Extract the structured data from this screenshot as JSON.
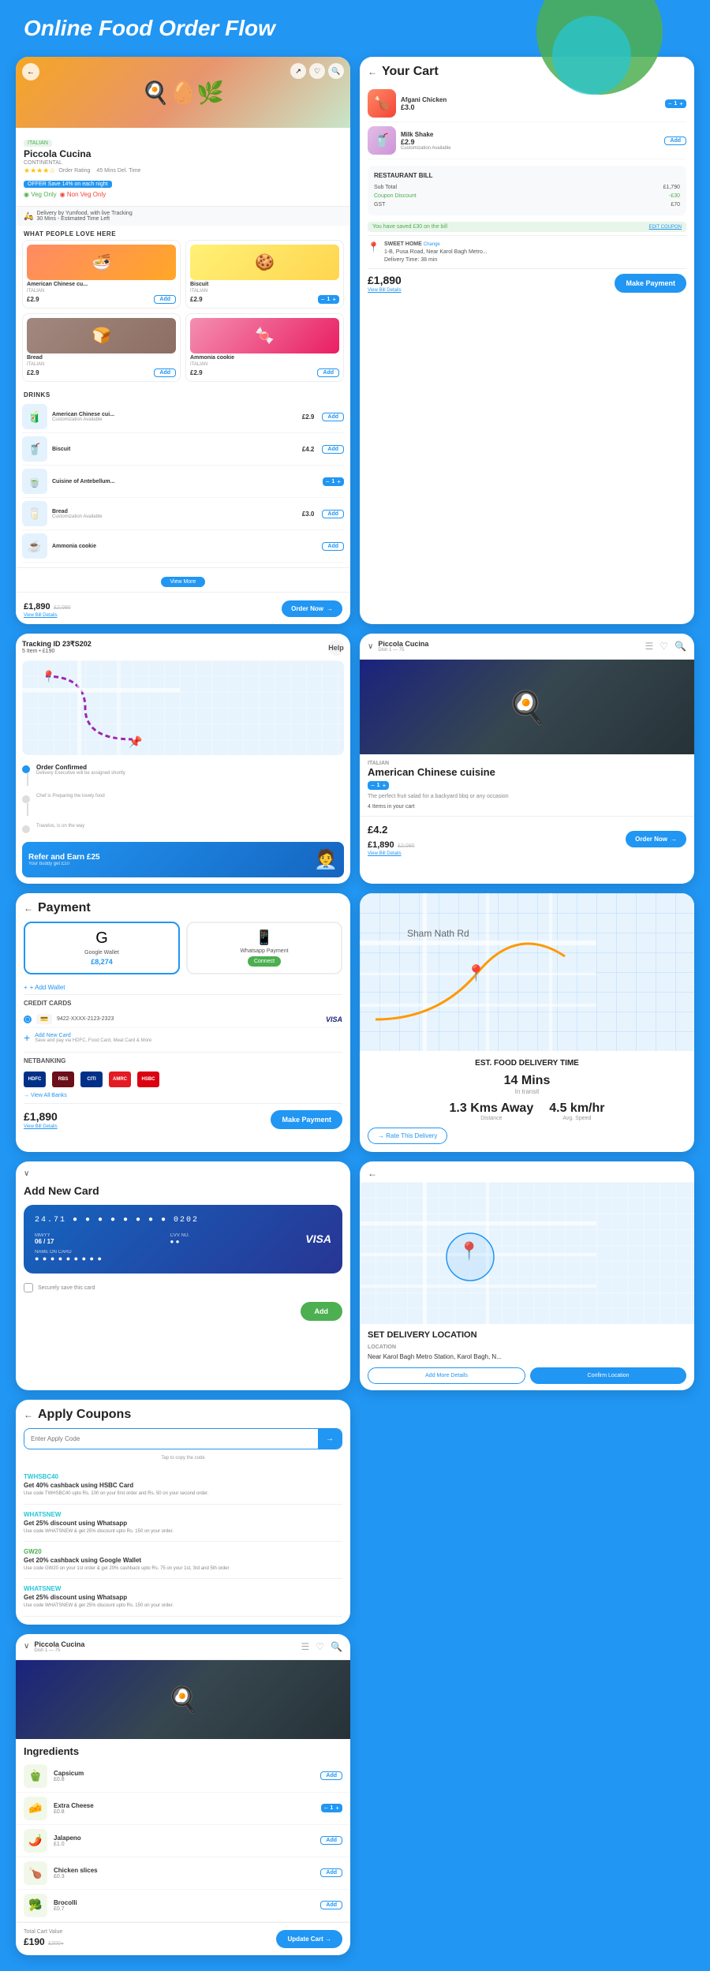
{
  "page": {
    "title": "Online Food Order Flow",
    "bg_color": "#2196F3"
  },
  "restaurant_card": {
    "name": "Piccola Cucina",
    "tag": "ITALIAN",
    "cuisine": "CONTINENTAL",
    "rating": "4.2",
    "rating_count": "Order Rating",
    "time": "45 Mins Del. Time",
    "offer": "OFFER Save 14% on each night",
    "veg_only": "Veg Only",
    "non_veg": "Non Veg Only",
    "delivery_by": "Delivery by Yumfood, with live Tracking",
    "delivery_time": "30 Mins - Estimated Time Left",
    "section_title": "WHAT PEOPLE LOVE HERE",
    "foods": [
      {
        "name": "American Chinese cu...",
        "cat": "ITALIAN",
        "price": "£2.9",
        "emoji": "🍜",
        "color": "orange",
        "has_qty": false
      },
      {
        "name": "Biscuit",
        "cat": "ITALIAN",
        "price": "£2.9",
        "emoji": "🍪",
        "color": "yellow",
        "has_qty": true
      },
      {
        "name": "Bread",
        "cat": "ITALIAN",
        "price": "£2.9",
        "emoji": "🍞",
        "color": "brown",
        "has_qty": false
      },
      {
        "name": "Ammonia cookie",
        "cat": "ITALIAN",
        "price": "£2.9",
        "emoji": "🍬",
        "color": "pink",
        "has_qty": false
      }
    ],
    "drinks_title": "DRINKS",
    "drinks": [
      {
        "name": "American Chinese cui...",
        "price": "£2.9",
        "sub": "Customization Available",
        "emoji": "🧃"
      },
      {
        "name": "Biscuit",
        "price": "£4.2",
        "sub": "",
        "emoji": "🥤"
      },
      {
        "name": "Cuisine of Antebellum...",
        "price": "",
        "sub": "",
        "emoji": "🍵"
      },
      {
        "name": "Bread",
        "price": "£3.0",
        "sub": "Customization Available",
        "emoji": "🥛"
      },
      {
        "name": "Ammonia cookie",
        "price": "",
        "sub": "",
        "emoji": "☕"
      }
    ],
    "view_more": "View More",
    "cart_price": "£1,890",
    "cart_original": "£2,090",
    "view_bill": "View Bill Details",
    "order_btn": "Order Now"
  },
  "cart_card": {
    "title": "Your Cart",
    "items": [
      {
        "name": "Afgani Chicken",
        "price": "£3.0",
        "emoji": "🍗",
        "color": "chicken",
        "has_qty": true
      },
      {
        "name": "Milk Shake",
        "price": "£2.9",
        "custom": "Customization Available",
        "emoji": "🥤",
        "color": "milkshake",
        "has_qty": false
      }
    ],
    "bill_title": "RESTAURANT BILL",
    "sub_total_label": "Sub Total",
    "sub_total": "£1,790",
    "discount_label": "Coupon Discount",
    "discount": "-£30",
    "gst_label": "GST",
    "gst": "£70",
    "saved_text": "You have saved £30 on the bill",
    "edit_coupon": "EDIT COUPON",
    "address_name": "SWEET HOME",
    "address_change": "Change",
    "address": "1-B, Pusa Road, Near Karol Bagh Metro...",
    "delivery_time": "Delivery Time: 38 min",
    "total": "£1,890",
    "view_bill": "View Bill Details",
    "pay_btn": "Make Payment"
  },
  "tracking_card": {
    "tracking_label": "Tracking ID 23₹S202",
    "items": "5 Item  •  £190",
    "help": "Help",
    "status_confirmed": "Order Confirmed",
    "status_confirmed_sub": "Delivery Executive will be assigned shortly",
    "status_preparing": "Chef is Preparing the lovely food",
    "status_delivery": "Travelos, is on the way",
    "refer_title": "Refer and Earn £25",
    "refer_sub": "Your buddy get £10"
  },
  "payment_card": {
    "title": "Payment",
    "google_pay": "Google Wallet",
    "google_amount": "£8,274",
    "whatsapp": "Whatsapp Payment",
    "whatsapp_connect": "Connect",
    "add_wallet": "+ Add Wallet",
    "credit_cards_label": "CREDIT CARDS",
    "card_number": "9422-XXXX-2123-2323",
    "card_type": "VISA",
    "add_new_card": "Add New Card",
    "add_new_sub": "Save and pay via HDFC, Food Card, Meal Card & More",
    "netbanking_label": "NETBANKING",
    "banks": [
      "HDFC",
      "RBS",
      "CITI",
      "AMERICA",
      "HSBC"
    ],
    "view_all_banks": "→ View All Banks",
    "total": "£1,890",
    "view_bill": "View Bill Details",
    "pay_btn": "Make Payment"
  },
  "delivery_map_card": {
    "est_label": "EST. FOOD DELIVERY TIME",
    "time_value": "14 Mins",
    "time_unit": "In transit",
    "distance_value": "1.3 Kms Away",
    "distance_label": "Distance",
    "speed_value": "4.5 km/hr",
    "speed_label": "Avg. Speed",
    "rate_btn": "→ Rate This Delivery"
  },
  "location_card": {
    "location_label": "Location",
    "location_value": "Near Karol Bagh Metro Station, Karol Bagh, N...",
    "add_more_btn": "Add More Details",
    "confirm_btn": "Confirm Location"
  },
  "coupons_card": {
    "title": "Apply Coupons",
    "input_placeholder": "Enter Apply Code",
    "apply_arrow": "→",
    "tap_hint": "Tap to copy the code",
    "coupons": [
      {
        "code": "TWHSBC40",
        "code_color": "teal",
        "title": "Get 40% cashback using HSBC Card",
        "desc": "Use code TWHSBC40 upto Rs. 100 on your first order and Rs. 50 on your second order."
      },
      {
        "code": "WHATSNEW",
        "code_color": "teal",
        "title": "Get 25% discount using Whatsapp",
        "desc": "Use code WHATSNEW & get 25% discount upto Rs. 150 on your order."
      },
      {
        "code": "GW20",
        "code_color": "green",
        "title": "Get 20% cashback using Google Wallet",
        "desc": "Use code GW20 on your 1st order & get 20% cashback upto Rs. 75 on your 1st, 3rd and 5th order"
      },
      {
        "code": "WHATSNEW",
        "code_color": "teal",
        "title": "Get 25% discount using Whatsapp",
        "desc": "Use code WHATSNEW & get 25% discount upto Rs. 150 on your order."
      }
    ]
  },
  "dish_card": {
    "restaurant": "Piccola Cucina",
    "dish_label": "Dish 1 — 75",
    "tag": "ITALIAN",
    "name": "American Chinese cuisine",
    "price": "£4.2",
    "desc": "The perfect fruit salad for a backyard bbq or any occasion",
    "items_in_cart": "4 Items in your cart",
    "cart_price": "£1,890",
    "cart_original": "£2,090",
    "order_btn": "Order Now"
  },
  "add_card": {
    "title": "Add New Card",
    "card_number": "24.71 ● ● ● ● ● ● ● ● 0202",
    "expiry_label": "MM/YY",
    "expiry_value": "06 / 17",
    "cvv_label": "CVV NO.",
    "name_label": "NAME ON CARD",
    "name_value": "● ● ● ● ● ● ● ● ●",
    "secure_label": "Securely save this card",
    "add_btn": "Add"
  },
  "ingredients_card": {
    "restaurant": "Piccola Cucina",
    "dish_label": "Dish 1 — 75",
    "title": "Ingredients",
    "items": [
      {
        "name": "Capsicum",
        "price": "£0.8",
        "emoji": "🫑"
      },
      {
        "name": "Extra Cheese",
        "price": "£0.8",
        "emoji": "🧀",
        "has_qty": true
      },
      {
        "name": "Jalapeno",
        "price": "£1.0",
        "emoji": "🌶️"
      },
      {
        "name": "Chicken slices",
        "price": "£0.3",
        "emoji": "🍗"
      },
      {
        "name": "Brocolli",
        "price": "£0.7",
        "emoji": "🥦"
      }
    ],
    "total_label": "Total Cart Value",
    "total": "£190",
    "total_original": "£200+",
    "update_btn": "Update Cart →"
  }
}
